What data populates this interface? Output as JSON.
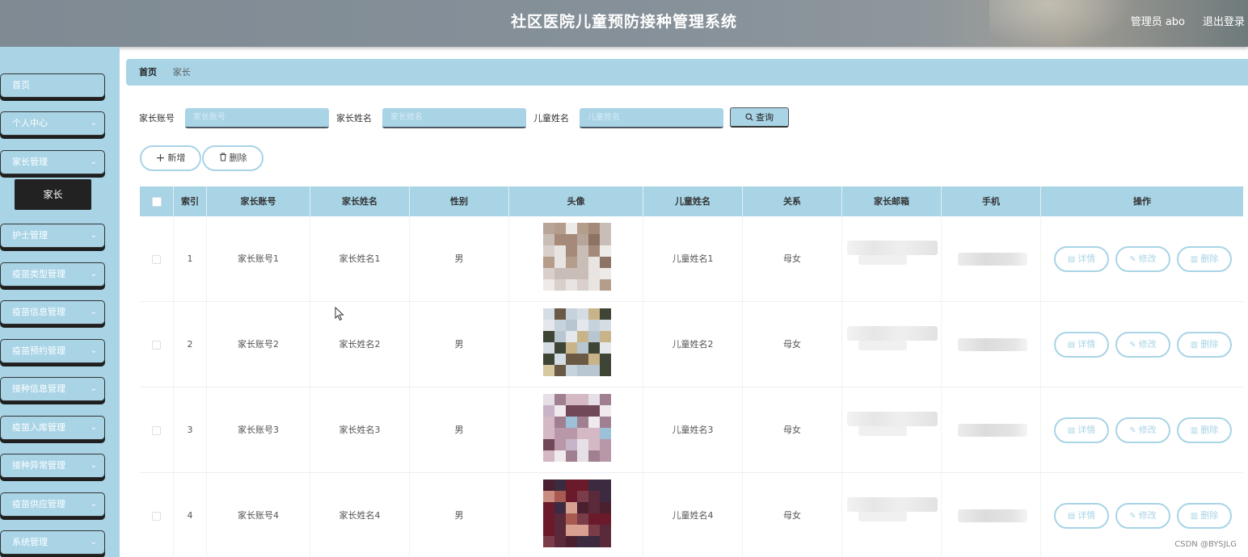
{
  "header": {
    "title": "社区医院儿童预防接种管理系统",
    "user": "管理员 abo",
    "logout": "退出登录"
  },
  "sidebar": {
    "items": [
      {
        "label": "首页",
        "has_chevron": false
      },
      {
        "label": "个人中心",
        "has_chevron": true
      },
      {
        "label": "家长管理",
        "has_chevron": true
      },
      {
        "label": "护士管理",
        "has_chevron": true
      },
      {
        "label": "疫苗类型管理",
        "has_chevron": true
      },
      {
        "label": "疫苗信息管理",
        "has_chevron": true
      },
      {
        "label": "疫苗预约管理",
        "has_chevron": true
      },
      {
        "label": "接种信息管理",
        "has_chevron": true
      },
      {
        "label": "疫苗入库管理",
        "has_chevron": true
      },
      {
        "label": "接种异常管理",
        "has_chevron": true
      },
      {
        "label": "疫苗供应管理",
        "has_chevron": true
      },
      {
        "label": "系统管理",
        "has_chevron": true
      }
    ],
    "active_submenu": "家长"
  },
  "breadcrumb": {
    "home": "首页",
    "separator": "/",
    "current": "家长"
  },
  "search": {
    "fields": [
      {
        "label": "家长账号",
        "placeholder": "家长账号"
      },
      {
        "label": "家长姓名",
        "placeholder": "家长姓名"
      },
      {
        "label": "儿童姓名",
        "placeholder": "儿童姓名"
      }
    ],
    "button": "查询"
  },
  "actions": {
    "add": "新增",
    "delete": "删除"
  },
  "table": {
    "columns": [
      "",
      "索引",
      "家长账号",
      "家长姓名",
      "性别",
      "头像",
      "儿童姓名",
      "关系",
      "家长邮箱",
      "手机",
      "操作"
    ],
    "rows": [
      {
        "index": "1",
        "account": "家长账号1",
        "name": "家长姓名1",
        "gender": "男",
        "child": "儿童姓名1",
        "relation": "母女"
      },
      {
        "index": "2",
        "account": "家长账号2",
        "name": "家长姓名2",
        "gender": "男",
        "child": "儿童姓名2",
        "relation": "母女"
      },
      {
        "index": "3",
        "account": "家长账号3",
        "name": "家长姓名3",
        "gender": "男",
        "child": "儿童姓名3",
        "relation": "母女"
      },
      {
        "index": "4",
        "account": "家长账号4",
        "name": "家长姓名4",
        "gender": "男",
        "child": "儿童姓名4",
        "relation": "母女"
      }
    ],
    "row_actions": {
      "detail": "详情",
      "edit": "修改",
      "delete": "删除"
    }
  },
  "watermark": "CSDN @BYSJLG",
  "colors": {
    "accent": "#a8d4e6",
    "dark": "#222222"
  }
}
